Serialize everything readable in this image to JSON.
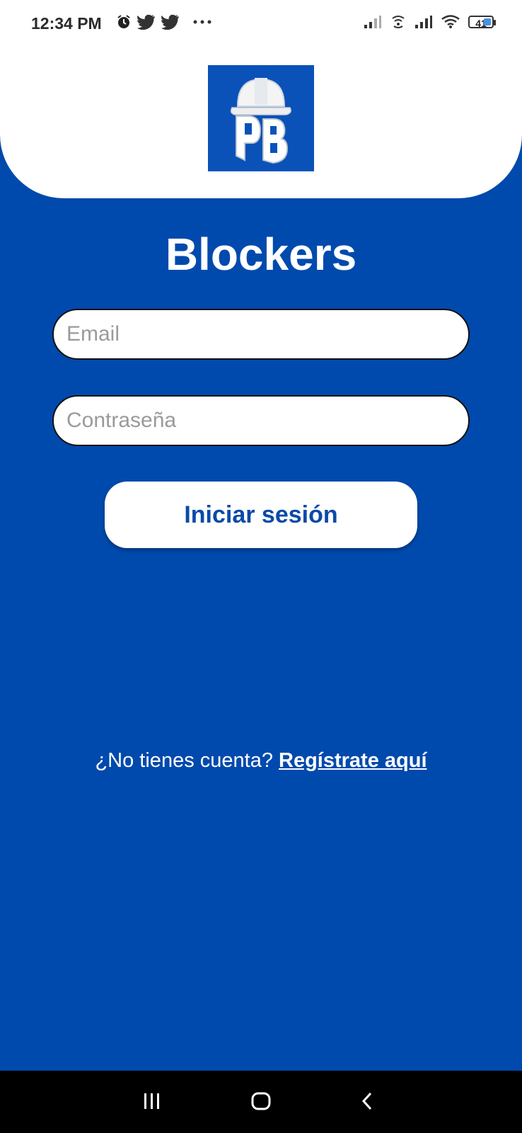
{
  "status_bar": {
    "time": "12:34 PM",
    "left_icons": [
      "alarm-icon",
      "twitter-icon",
      "twitter-icon",
      "more-icon"
    ],
    "right_icons": [
      "signal-icon",
      "hotspot-icon",
      "signal-icon",
      "wifi-icon"
    ],
    "battery": "41"
  },
  "app": {
    "title": "Blockers",
    "logo_icon": "pb-helmet-logo"
  },
  "form": {
    "email_placeholder": "Email",
    "password_placeholder": "Contraseña",
    "login_label": "Iniciar sesión"
  },
  "signup": {
    "prompt": "¿No tienes cuenta? ",
    "link": "Regístrate aquí"
  },
  "nav": {
    "items": [
      "recents-icon",
      "home-icon",
      "back-icon"
    ]
  },
  "colors": {
    "primary": "#004aad",
    "surface": "#ffffff",
    "button_text": "#0a4aa7"
  }
}
